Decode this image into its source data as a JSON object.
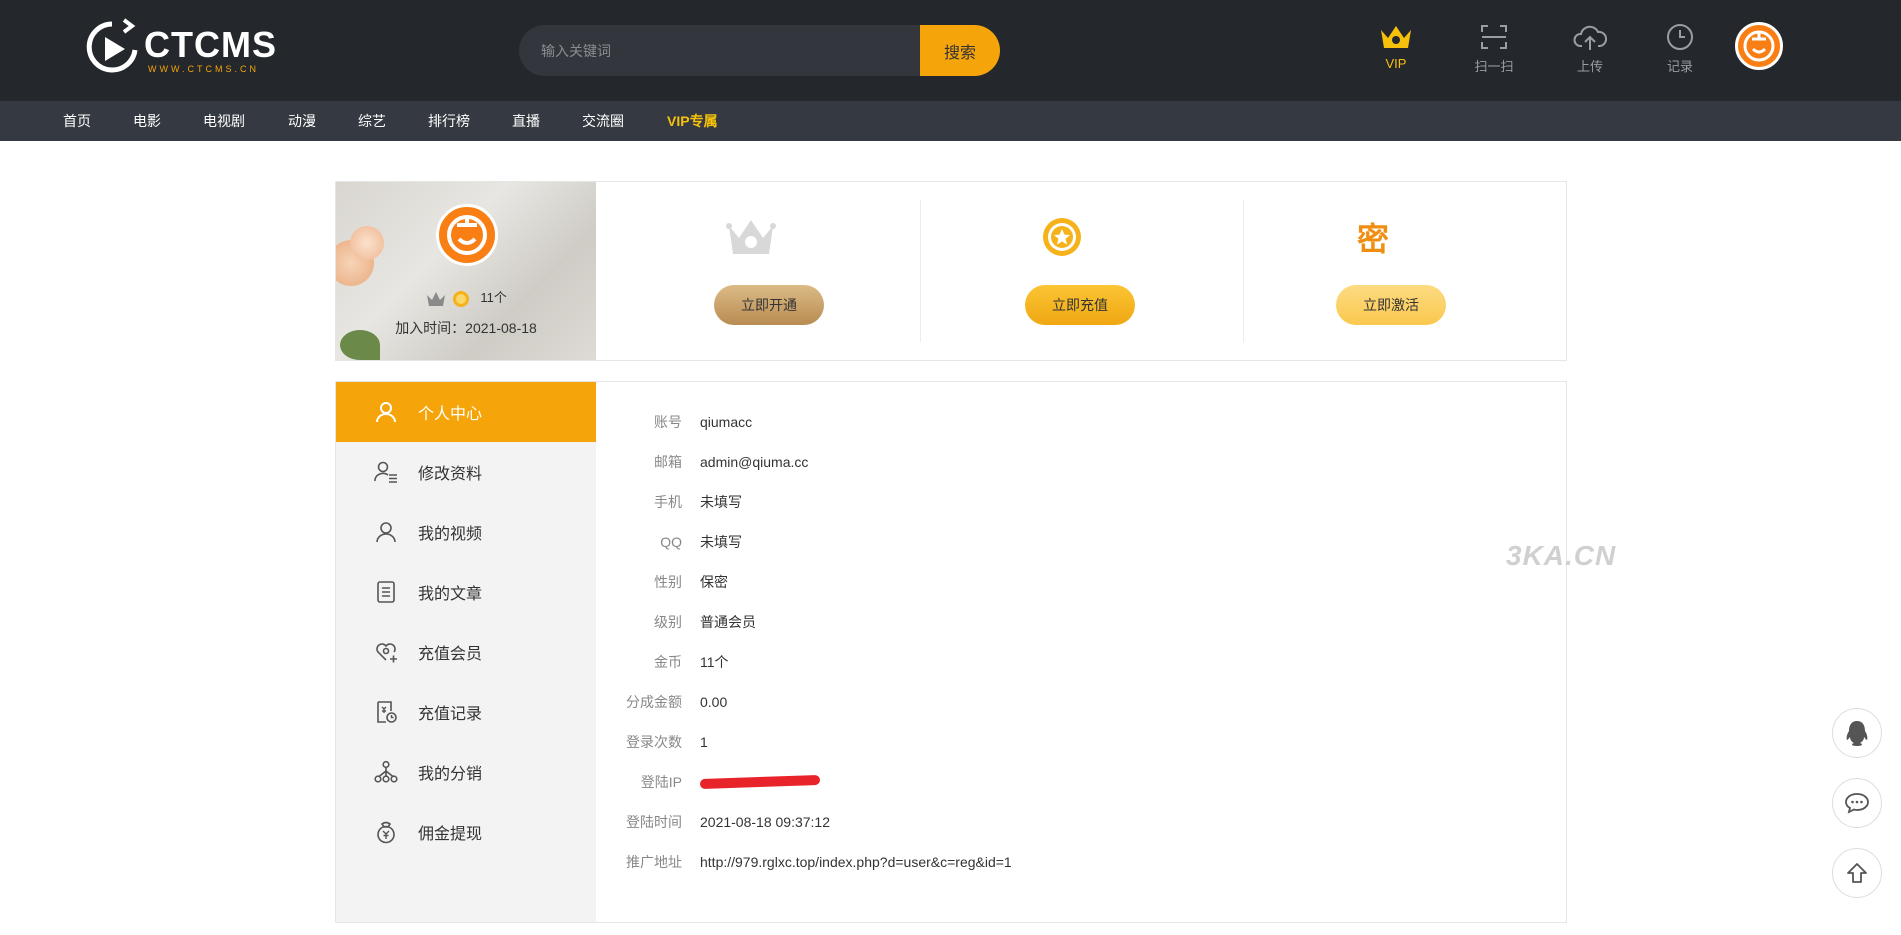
{
  "header": {
    "logo_text": "CTCMS",
    "logo_sub": "WWW.CTCMS.CN",
    "search_placeholder": "输入关键词",
    "search_button": "搜索",
    "actions": [
      {
        "label": "VIP",
        "icon": "crown-icon"
      },
      {
        "label": "扫一扫",
        "icon": "scan-icon"
      },
      {
        "label": "上传",
        "icon": "cloud-upload-icon"
      },
      {
        "label": "记录",
        "icon": "clock-icon"
      }
    ]
  },
  "nav": [
    "首页",
    "电影",
    "电视剧",
    "动漫",
    "综艺",
    "排行榜",
    "直播",
    "交流圈",
    "VIP专属"
  ],
  "profile": {
    "coins": "11个",
    "join_time": "加入时间：2021-08-18"
  },
  "promos": [
    {
      "icon": "vip-crown-icon",
      "button": "立即开通",
      "color": "#c9a36a"
    },
    {
      "icon": "gold-star-coin-icon",
      "button": "立即充值",
      "color": "#f5b21a"
    },
    {
      "icon": "mi-key-icon",
      "glyph": "密",
      "button": "立即激活",
      "color": "#fdd26b"
    }
  ],
  "sidebar": [
    {
      "label": "个人中心",
      "icon": "user-icon",
      "active": true
    },
    {
      "label": "修改资料",
      "icon": "user-edit-icon"
    },
    {
      "label": "我的视频",
      "icon": "user-icon"
    },
    {
      "label": "我的文章",
      "icon": "document-icon"
    },
    {
      "label": "充值会员",
      "icon": "heart-plus-icon"
    },
    {
      "label": "充值记录",
      "icon": "receipt-icon"
    },
    {
      "label": "我的分销",
      "icon": "network-icon"
    },
    {
      "label": "佣金提现",
      "icon": "yen-bag-icon"
    }
  ],
  "info": [
    {
      "label": "账号",
      "value": "qiumacc"
    },
    {
      "label": "邮箱",
      "value": "admin@qiuma.cc"
    },
    {
      "label": "手机",
      "value": "未填写"
    },
    {
      "label": "QQ",
      "value": "未填写"
    },
    {
      "label": "性别",
      "value": "保密"
    },
    {
      "label": "级别",
      "value": "普通会员"
    },
    {
      "label": "金币",
      "value": "11个"
    },
    {
      "label": "分成金额",
      "value": "0.00"
    },
    {
      "label": "登录次数",
      "value": "1"
    },
    {
      "label": "登陆IP",
      "value": "",
      "redacted": true
    },
    {
      "label": "登陆时间",
      "value": "2021-08-18 09:37:12"
    },
    {
      "label": "推广地址",
      "value": "http://979.rglxc.top/index.php?d=user&c=reg&id=1"
    }
  ],
  "watermark": "3KA.CN",
  "floating": [
    {
      "icon": "qq-penguin-icon"
    },
    {
      "icon": "chat-bubble-icon"
    },
    {
      "icon": "arrow-up-icon"
    }
  ],
  "colors": {
    "accent": "#f5a50a",
    "topbar": "#24272c",
    "nav": "#353a42",
    "vip": "#f5c10a"
  }
}
